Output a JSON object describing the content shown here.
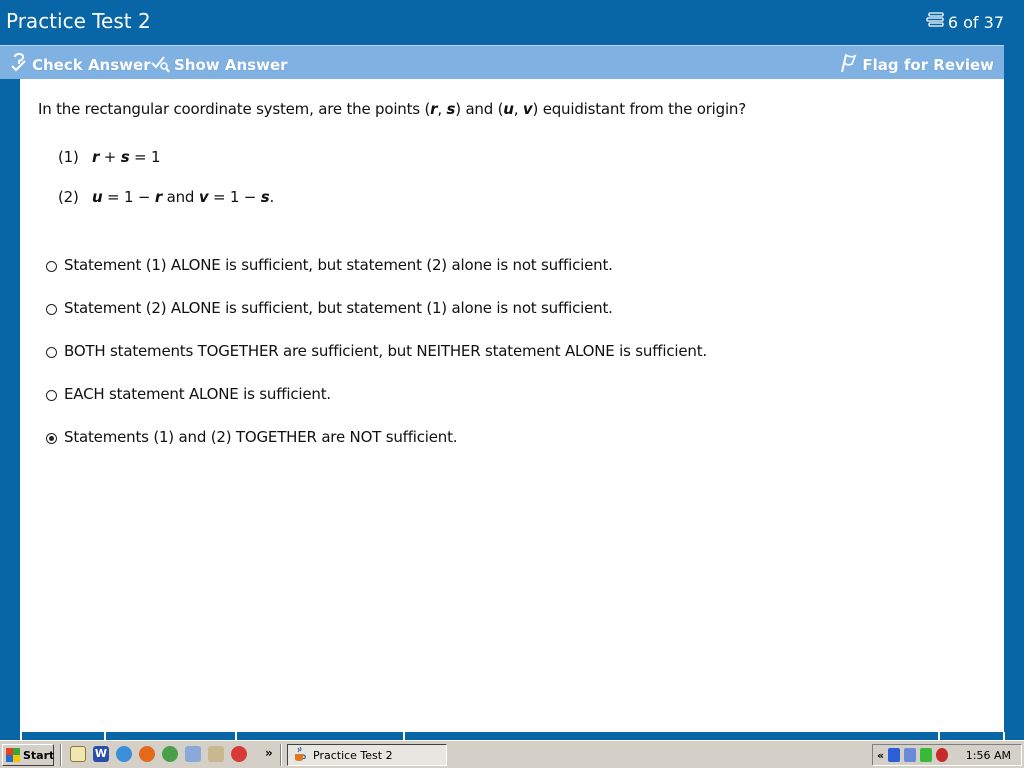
{
  "window": {
    "title": "Practice Test 2",
    "progress": "6 of 37"
  },
  "toolbar": {
    "check_answer": "Check Answer",
    "show_answer": "Show Answer",
    "flag_review": "Flag for Review"
  },
  "question": {
    "prefix": "In the rectangular coordinate system, are the points (",
    "v1": "r",
    "c1": ", ",
    "v2": "s",
    "mid": ") and (",
    "v3": "u",
    "c2": ", ",
    "v4": "v",
    "suffix": ") equidistant from the origin?"
  },
  "statements": {
    "s1": {
      "num": "(1)",
      "a": "r",
      "op1": " + ",
      "b": "s",
      "rest": " = 1"
    },
    "s2": {
      "num": "(2)",
      "a": "u",
      "eq1": " = 1 − ",
      "b": "r",
      "and": " and ",
      "c": "v",
      "eq2": " = 1 − ",
      "d": "s",
      "end": "."
    }
  },
  "choices": [
    {
      "label": "Statement (1) ALONE is sufficient, but statement (2) alone is not sufficient.",
      "selected": false
    },
    {
      "label": "Statement (2) ALONE is sufficient, but statement (1) alone is not sufficient.",
      "selected": false
    },
    {
      "label": "BOTH statements TOGETHER are sufficient, but NEITHER statement ALONE is sufficient.",
      "selected": false
    },
    {
      "label": "EACH statement ALONE is sufficient.",
      "selected": false
    },
    {
      "label": "Statements (1) and (2) TOGETHER are NOT sufficient.",
      "selected": true
    }
  ],
  "taskbar": {
    "start_label": "Start",
    "chevron": "»",
    "task_label": "Practice Test 2",
    "tray_chevron": "«",
    "clock": "1:56 AM"
  },
  "colors": {
    "header_bg": "#0865a6",
    "toolbar_bg": "#7fb1e2",
    "taskbar_bg": "#d4d0c8"
  }
}
